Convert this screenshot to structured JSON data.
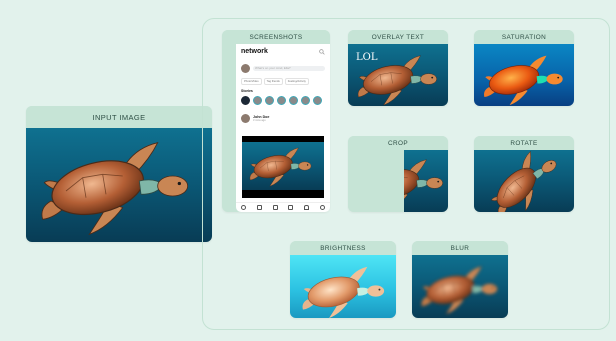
{
  "input": {
    "label": "INPUT IMAGE"
  },
  "screenshots": {
    "label": "SCREENSHOTS",
    "app_name": "network",
    "composer_placeholder": "What's on your mind, Ella?",
    "actions": [
      "Photo/Video",
      "Tag friends",
      "Feeling/Activity"
    ],
    "stories_label": "Stories",
    "post_author": "John Doe",
    "post_meta": "3 mins ago",
    "icon_names": [
      "search-icon",
      "home-icon",
      "message-icon",
      "video-icon",
      "calendar-icon",
      "bell-icon",
      "profile-icon"
    ]
  },
  "transforms": [
    {
      "id": "overlay-text",
      "label": "OVERLAY TEXT",
      "overlay": "LOL"
    },
    {
      "id": "saturation",
      "label": "SATURATION"
    },
    {
      "id": "crop",
      "label": "CROP"
    },
    {
      "id": "rotate",
      "label": "ROTATE"
    },
    {
      "id": "brightness",
      "label": "BRIGHTNESS"
    },
    {
      "id": "blur",
      "label": "BLUR"
    }
  ],
  "colors": {
    "background": "#e2f2ec",
    "label_band": "#c6e4d6",
    "frame_border": "#c3e2d3",
    "sea": "#0b5a78"
  }
}
